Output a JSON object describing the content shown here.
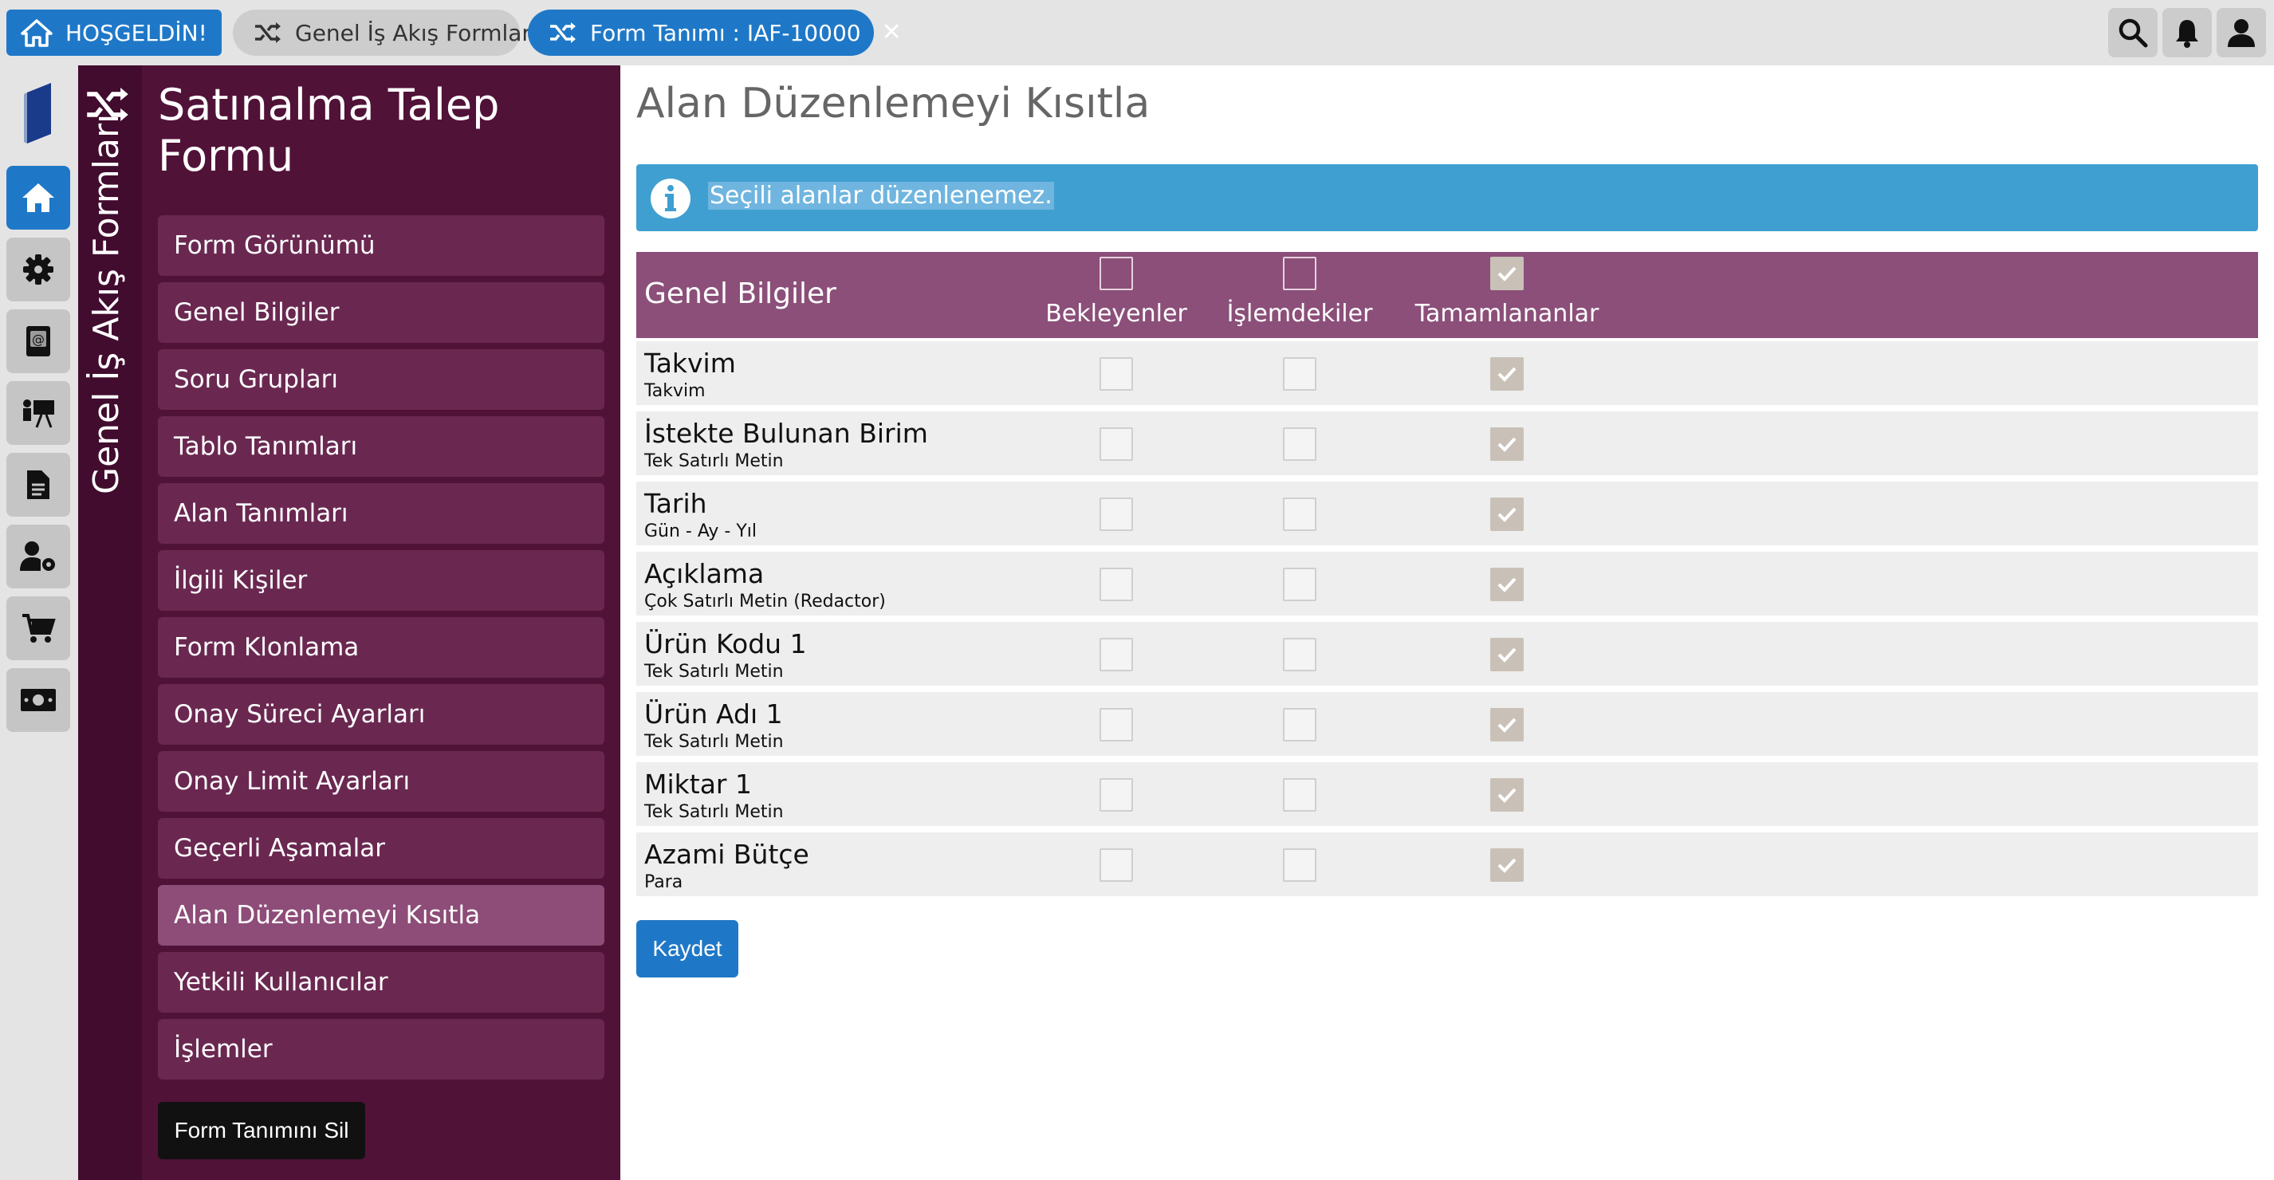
{
  "topbar": {
    "welcome_tab": "HOŞGELDİN!",
    "flows_tab": "Genel İş Akış Formları",
    "form_tab": "Form Tanımı : IAF-10000",
    "close_symbol": "✕",
    "icons": [
      "search-icon",
      "bell-icon",
      "user-icon"
    ]
  },
  "rail": {
    "icons": [
      "book-icon",
      "home-icon",
      "gear-icon",
      "contacts-icon",
      "presentation-icon",
      "document-icon",
      "user-settings-icon",
      "cart-icon",
      "money-icon"
    ],
    "active": "home-icon"
  },
  "side_panel": {
    "vertical_title": "Genel İş Akış Formları",
    "form_title": "Satınalma Talep Formu",
    "items": [
      {
        "label": "Form Görünümü"
      },
      {
        "label": "Genel Bilgiler"
      },
      {
        "label": "Soru Grupları"
      },
      {
        "label": "Tablo Tanımları"
      },
      {
        "label": "Alan Tanımları"
      },
      {
        "label": "İlgili Kişiler"
      },
      {
        "label": "Form Klonlama"
      },
      {
        "label": "Onay Süreci Ayarları"
      },
      {
        "label": "Onay Limit Ayarları"
      },
      {
        "label": "Geçerli Aşamalar"
      },
      {
        "label": "Alan Düzenlemeyi Kısıtla"
      },
      {
        "label": "Yetkili Kullanıcılar"
      },
      {
        "label": "İşlemler"
      }
    ],
    "active_item": "Alan Düzenlemeyi Kısıtla",
    "delete_button": "Form Tanımını Sil"
  },
  "main": {
    "page_title": "Alan Düzenlemeyi Kısıtla",
    "info_text": "Seçili alanlar düzenlenemez.",
    "table": {
      "section_title": "Genel Bilgiler",
      "columns": [
        {
          "label": "Bekleyenler",
          "checked": false
        },
        {
          "label": "İşlemdekiler",
          "checked": false
        },
        {
          "label": "Tamamlananlar",
          "checked": true
        }
      ],
      "rows": [
        {
          "name": "Takvim",
          "type": "Takvim",
          "checks": [
            false,
            false,
            true
          ]
        },
        {
          "name": "İstekte Bulunan Birim",
          "type": "Tek Satırlı Metin",
          "checks": [
            false,
            false,
            true
          ]
        },
        {
          "name": "Tarih",
          "type": "Gün - Ay - Yıl",
          "checks": [
            false,
            false,
            true
          ]
        },
        {
          "name": "Açıklama",
          "type": "Çok Satırlı Metin (Redactor)",
          "checks": [
            false,
            false,
            true
          ]
        },
        {
          "name": "Ürün Kodu 1",
          "type": "Tek Satırlı Metin",
          "checks": [
            false,
            false,
            true
          ]
        },
        {
          "name": "Ürün Adı 1",
          "type": "Tek Satırlı Metin",
          "checks": [
            false,
            false,
            true
          ]
        },
        {
          "name": "Miktar 1",
          "type": "Tek Satırlı Metin",
          "checks": [
            false,
            false,
            true
          ]
        },
        {
          "name": "Azami Bütçe",
          "type": "Para",
          "checks": [
            false,
            false,
            true
          ]
        }
      ]
    },
    "save_button": "Kaydet"
  },
  "colors": {
    "accent_blue": "#1f78c7",
    "panel_purple": "#511238",
    "header_purple": "#8b4f79",
    "info_blue": "#3f9fd0"
  }
}
